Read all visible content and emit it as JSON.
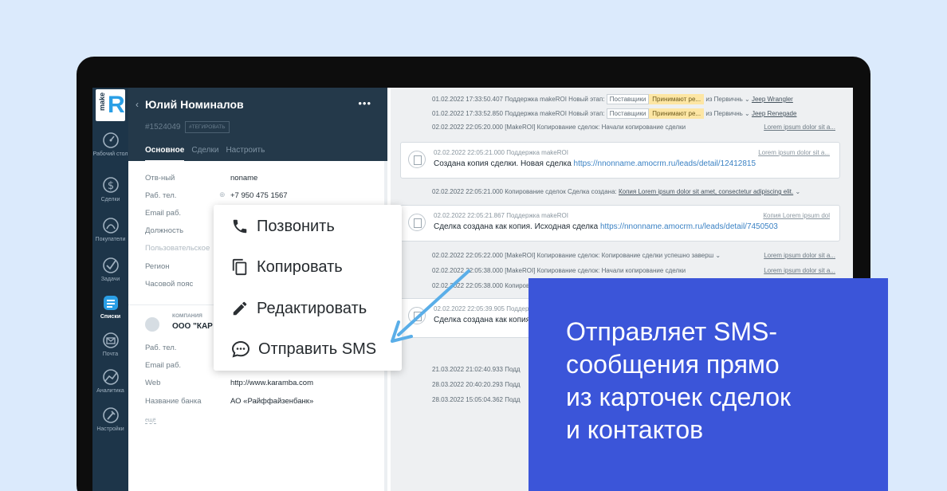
{
  "logo": {
    "small": "make",
    "letter": "R"
  },
  "nav": [
    {
      "label": "Рабочий стол",
      "icon": "dashboard-icon"
    },
    {
      "label": "Сделки",
      "icon": "dollar-icon"
    },
    {
      "label": "Покупатели",
      "icon": "buyers-icon"
    },
    {
      "label": "Задачи",
      "icon": "check-icon"
    },
    {
      "label": "Списки",
      "icon": "lists-icon",
      "active": true
    },
    {
      "label": "Почта",
      "icon": "mail-icon"
    },
    {
      "label": "Аналитика",
      "icon": "analytics-icon"
    },
    {
      "label": "Настройки",
      "icon": "settings-icon"
    }
  ],
  "contact": {
    "back": "‹",
    "name": "Юлий Номиналов",
    "menu_dots": "•••",
    "id": "#1524049",
    "tag_button": "#ТЕГИРОВАТЬ",
    "tabs": [
      "Основное",
      "Сделки",
      "Настроить"
    ],
    "fields": [
      {
        "label": "Отв-ный",
        "value": "noname"
      },
      {
        "label": "Раб. тел.",
        "value": "+7 950 475 1567"
      },
      {
        "label": "Email раб.",
        "value": ""
      },
      {
        "label": "Должность",
        "value": ""
      },
      {
        "label": "Пользовательское",
        "value": ""
      },
      {
        "label": "Регион",
        "value": ""
      },
      {
        "label": "Часовой пояс",
        "value": ""
      }
    ],
    "company": {
      "caption": "КОМПАНИЯ",
      "name": "ООО \"КАР",
      "fields": [
        {
          "label": "Раб. тел.",
          "value": ""
        },
        {
          "label": "Email раб.",
          "value": ""
        },
        {
          "label": "Web",
          "value": "http://www.karamba.com"
        },
        {
          "label": "Название банка",
          "value": "АО «Райффайзенбанк»"
        }
      ],
      "more": "ещё"
    }
  },
  "feed": {
    "events": [
      {
        "text": "01.02.2022 17:33:50.407 Поддержка makeROI Новый этап:",
        "tag1": "Поставщики",
        "tag2": "Принимают ре...",
        "from": "из Первичнь ⌄",
        "link": "Jeep Wrangler"
      },
      {
        "text": "01.02.2022 17:33:52.850 Поддержка makeROI Новый этап:",
        "tag1": "Поставщики",
        "tag2": "Принимают ре...",
        "from": "из Первичнь ⌄",
        "link": "Jeep Renegade"
      },
      {
        "text": "02.02.2022 22:05:20.000 [MakeROI] Копирование сделок: Начали копирование сделки",
        "right": "Lorem ipsum dolor sit a..."
      }
    ],
    "card1": {
      "meta": "02.02.2022 22:05:21.000 Поддержка makeROI",
      "text": "Создана копия сделки. Новая сделка",
      "url": "https://nnonname.amocrm.ru/leads/detail/12412815",
      "right": "Lorem ipsum dolor sit a..."
    },
    "event_mid": {
      "text": "02.02.2022 22:05:21.000 Копирование сделок Сделка создана:",
      "link": "Копия Lorem ipsum dolor sit amet, consectetur adipiscing elit.",
      "chev": "⌄"
    },
    "card2": {
      "meta": "02.02.2022 22:05:21.867 Поддержка makeROI",
      "text": "Сделка создана как копия. Исходная сделка",
      "url": "https://nnonname.amocrm.ru/leads/detail/7450503",
      "right": "Копия Lorem ipsum dol"
    },
    "events2": [
      {
        "text": "02.02.2022 22:05:22.000 [MakeROI] Копирование сделок: Копирование сделки успешно заверш ⌄",
        "right": "Lorem ipsum dolor sit a..."
      },
      {
        "text": "02.02.2022 22:05:38.000 [MakeROI] Копирование сделок: Начали копирование сделки",
        "right": "Lorem ipsum dolor sit a..."
      },
      {
        "text": "02.02.2022 22:05:38.000 Копирование сделок",
        "right": ""
      }
    ],
    "card3": {
      "meta": "02.02.2022 22:05:39.905 Поддер",
      "text": "Сделка создана как копия"
    },
    "events3": [
      {
        "text": "21.03.2022 21:02:40.933 Подд"
      },
      {
        "text": "28.03.2022 20:40:20.293 Подд"
      },
      {
        "text": "28.03.2022 15:05:04.362 Подд"
      }
    ]
  },
  "context_menu": [
    {
      "label": "Позвонить",
      "icon": "phone-icon"
    },
    {
      "label": "Копировать",
      "icon": "copy-icon"
    },
    {
      "label": "Редактировать",
      "icon": "pencil-icon"
    },
    {
      "label": "Отправить SMS",
      "icon": "sms-icon"
    }
  ],
  "promo": {
    "lines": [
      "Отправляет SMS-",
      "сообщения прямо",
      "из карточек сделок",
      "и контактов"
    ],
    "background": "#3b55d9",
    "arrow_color": "#5aaee8"
  }
}
